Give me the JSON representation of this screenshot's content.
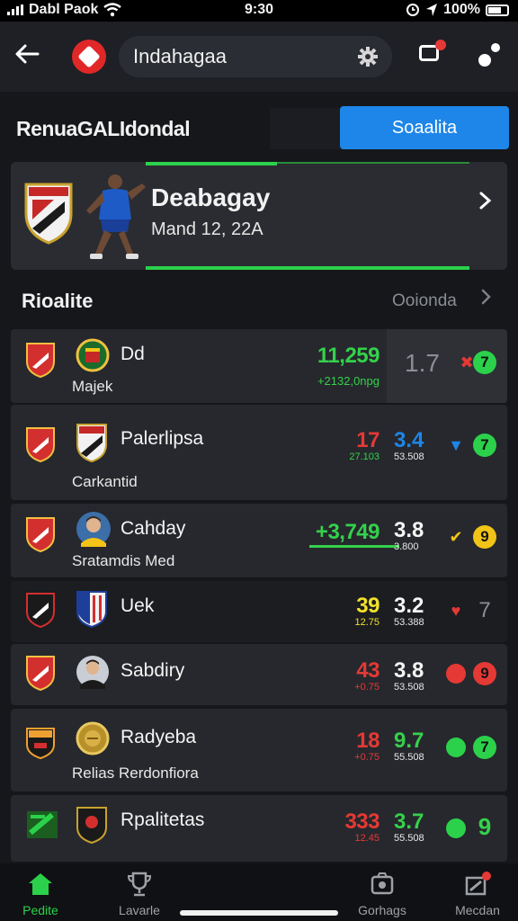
{
  "status_bar": {
    "carrier": "Dabl Paok",
    "time": "9:30",
    "battery": "100%"
  },
  "top_bar": {
    "search_text": "Indahagaa"
  },
  "section": {
    "title": "RenuaGALIdondal",
    "primary_button": "Soaalita"
  },
  "featured": {
    "team": "Deabagay",
    "date": "Mand 12, 22A"
  },
  "subsection": {
    "title": "Rioalite",
    "link": "Ooionda"
  },
  "matches": [
    {
      "name": "Dd",
      "sub": "Majek",
      "main_value": "11,259",
      "main_sub": "+2132,0npg",
      "value2": "1.7",
      "value2_sub": "",
      "main_color": "#34d14b",
      "ind1": "✖",
      "ind1_color": "#e53935",
      "ind2": "7",
      "ind2_color": "#2bd14a"
    },
    {
      "name": "Palerlipsa",
      "sub": "Carkantid",
      "main_value": "17",
      "main_sub": "27.103",
      "value2": "3.4",
      "value2_sub": "53.508",
      "main_color": "#e53935",
      "ind1": "▼",
      "ind1_color": "#1d86e8",
      "ind2": "7",
      "ind2_color": "#2bd14a"
    },
    {
      "name": "Cahday",
      "sub": "Sratamdis Med",
      "main_value": "+3,749",
      "main_sub": "",
      "value2": "3.8",
      "value2_sub": "3.800",
      "main_color": "#34d14b",
      "ind1": "✔",
      "ind1_color": "#f2c417",
      "ind2": "9",
      "ind2_color": "#f2c417"
    },
    {
      "name": "Uek",
      "sub": "",
      "main_value": "39",
      "main_sub": "12.75",
      "value2": "3.2",
      "value2_sub": "53.388",
      "main_color": "#f2e12a",
      "ind1": "♥",
      "ind1_color": "#e53935",
      "ind2": "7",
      "ind2_color": "#3a3c42"
    },
    {
      "name": "Sabdiry",
      "sub": "",
      "main_value": "43",
      "main_sub": "+0.75",
      "value2": "3.8",
      "value2_sub": "53.508",
      "main_color": "#e53935",
      "ind1": "●",
      "ind1_color": "#e53935",
      "ind2": "9",
      "ind2_color": "#e53935"
    },
    {
      "name": "Radyeba",
      "sub": "Relias Rerdonfiora",
      "main_value": "18",
      "main_sub": "+0.75",
      "value2": "9.7",
      "value2_sub": "55.508",
      "main_color": "#e53935",
      "ind1": "●",
      "ind1_color": "#2bd14a",
      "ind2": "7",
      "ind2_color": "#2bd14a"
    },
    {
      "name": "Rpalitetas",
      "sub": "",
      "main_value": "333",
      "main_sub": "12.45",
      "value2": "3.7",
      "value2_sub": "55.508",
      "main_color": "#e53935",
      "ind1": "●",
      "ind1_color": "#2bd14a",
      "ind2": "9",
      "ind2_color": "#2bd14a"
    }
  ],
  "bottom_nav": [
    {
      "label": "Pedite"
    },
    {
      "label": "Lavarle"
    },
    {
      "label": "Gorhags"
    },
    {
      "label": "Mecdan"
    }
  ],
  "colors": {
    "accent_green": "#2bd14a",
    "accent_blue": "#1d86e8",
    "alert_red": "#e53935"
  }
}
